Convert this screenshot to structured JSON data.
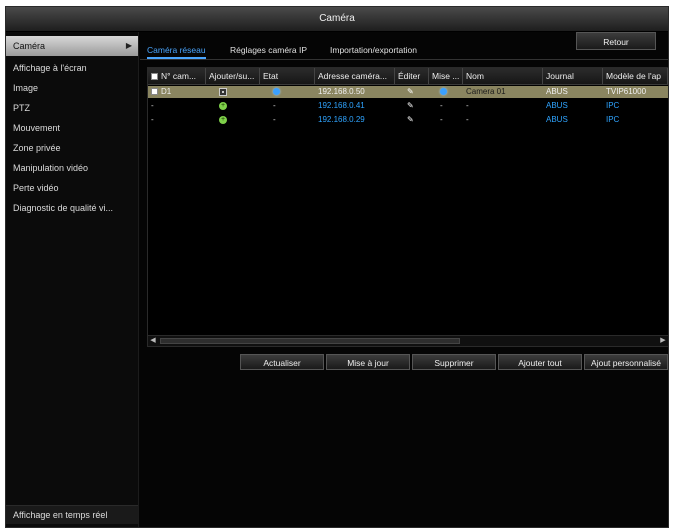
{
  "window": {
    "title": "Caméra"
  },
  "sidebar": {
    "items": [
      {
        "label": "Caméra"
      },
      {
        "label": "Affichage à l'écran"
      },
      {
        "label": "Image"
      },
      {
        "label": "PTZ"
      },
      {
        "label": "Mouvement"
      },
      {
        "label": "Zone privée"
      },
      {
        "label": "Manipulation vidéo"
      },
      {
        "label": "Perte vidéo"
      },
      {
        "label": "Diagnostic de qualité vi..."
      }
    ],
    "bottom_label": "Affichage en temps réel"
  },
  "tabs": [
    {
      "label": "Caméra réseau"
    },
    {
      "label": "Réglages caméra IP"
    },
    {
      "label": "Importation/exportation"
    }
  ],
  "table": {
    "headers": [
      "N° cam...",
      "Ajouter/su...",
      "Etat",
      "Adresse caméra...",
      "Éditer",
      "Mise ...",
      "Nom",
      "Journal",
      "Modèle de l'ap"
    ],
    "rows": [
      {
        "num": "D1",
        "add": "square-icon",
        "state": "status-dot-icon",
        "ip": "192.168.0.50",
        "edit": "pencil-icon",
        "update": "status-dot-icon",
        "name": "Camera 01",
        "journal": "ABUS",
        "model": "TVIP61000"
      },
      {
        "num": "-",
        "add": "add-icon",
        "state": "-",
        "ip": "192.168.0.41",
        "edit": "pencil-icon",
        "update": "-",
        "name": "-",
        "journal": "ABUS",
        "model": "IPC"
      },
      {
        "num": "-",
        "add": "add-icon",
        "state": "-",
        "ip": "192.168.0.29",
        "edit": "pencil-icon",
        "update": "-",
        "name": "-",
        "journal": "ABUS",
        "model": "IPC"
      }
    ]
  },
  "buttons": {
    "refresh": "Actualiser",
    "update": "Mise à jour",
    "delete": "Supprimer",
    "add_all": "Ajouter tout",
    "custom_add": "Ajout personnalisé",
    "back": "Retour"
  },
  "colors": {
    "accent_blue": "#2fa4ff",
    "selected_row": "#8a8560",
    "add_green": "#7fd14a"
  }
}
